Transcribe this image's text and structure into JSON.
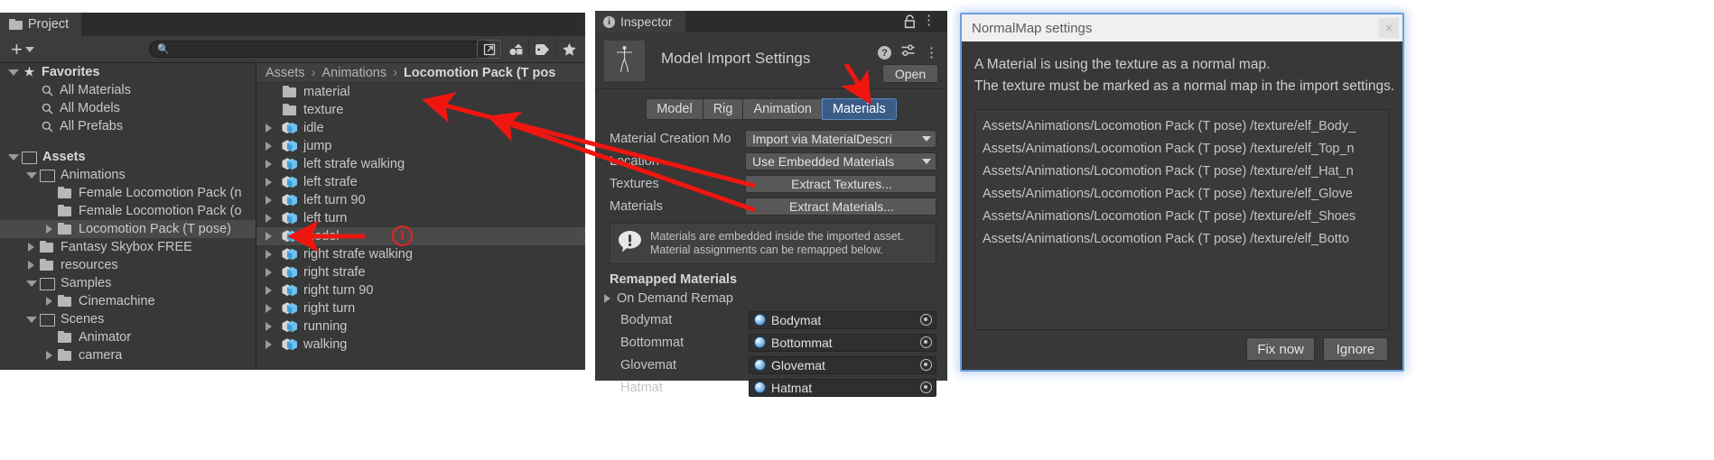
{
  "project_panel": {
    "tab_label": "Project",
    "toolbar": {
      "add_label": "+",
      "search_placeholder": "",
      "search_value": "",
      "icons": [
        "open-in-new-icon",
        "filter-by-type-icon",
        "filter-by-label-icon",
        "favorite-star-icon"
      ]
    },
    "tree": [
      {
        "label": "Favorites",
        "depth": 0,
        "twisty": "down",
        "icon": "star-icon",
        "bold": true,
        "selected": false
      },
      {
        "label": "All Materials",
        "depth": 1,
        "twisty": "none",
        "icon": "search-icon",
        "bold": false,
        "selected": false
      },
      {
        "label": "All Models",
        "depth": 1,
        "twisty": "none",
        "icon": "search-icon",
        "bold": false,
        "selected": false
      },
      {
        "label": "All Prefabs",
        "depth": 1,
        "twisty": "none",
        "icon": "search-icon",
        "bold": false,
        "selected": false
      },
      {
        "label": "",
        "depth": 0,
        "twisty": "none",
        "icon": "none",
        "bold": false,
        "selected": false
      },
      {
        "label": "Assets",
        "depth": 0,
        "twisty": "down",
        "icon": "folder-open-icon",
        "bold": true,
        "selected": false
      },
      {
        "label": "Animations",
        "depth": 1,
        "twisty": "down",
        "icon": "folder-open-icon",
        "bold": false,
        "selected": false
      },
      {
        "label": "Female Locomotion Pack  (n",
        "depth": 2,
        "twisty": "none",
        "icon": "folder-icon",
        "bold": false,
        "selected": false
      },
      {
        "label": "Female Locomotion Pack  (o",
        "depth": 2,
        "twisty": "none",
        "icon": "folder-icon",
        "bold": false,
        "selected": false
      },
      {
        "label": "Locomotion Pack  (T pose)",
        "depth": 2,
        "twisty": "right",
        "icon": "folder-icon",
        "bold": false,
        "selected": true
      },
      {
        "label": "Fantasy Skybox FREE",
        "depth": 1,
        "twisty": "right",
        "icon": "folder-icon",
        "bold": false,
        "selected": false
      },
      {
        "label": "resources",
        "depth": 1,
        "twisty": "right",
        "icon": "folder-icon",
        "bold": false,
        "selected": false
      },
      {
        "label": "Samples",
        "depth": 1,
        "twisty": "down",
        "icon": "folder-open-icon",
        "bold": false,
        "selected": false
      },
      {
        "label": "Cinemachine",
        "depth": 2,
        "twisty": "right",
        "icon": "folder-icon",
        "bold": false,
        "selected": false
      },
      {
        "label": "Scenes",
        "depth": 1,
        "twisty": "down",
        "icon": "folder-open-icon",
        "bold": false,
        "selected": false
      },
      {
        "label": "Animator",
        "depth": 2,
        "twisty": "none",
        "icon": "folder-icon",
        "bold": false,
        "selected": false
      },
      {
        "label": "camera",
        "depth": 2,
        "twisty": "right",
        "icon": "folder-icon",
        "bold": false,
        "selected": false
      }
    ],
    "breadcrumb": {
      "parts": [
        "Assets",
        "Animations"
      ],
      "current": "Locomotion Pack  (T pos"
    },
    "files": [
      {
        "label": "material",
        "icon": "folder-icon",
        "twisty": "none",
        "selected": false
      },
      {
        "label": "texture",
        "icon": "folder-icon",
        "twisty": "none",
        "selected": false
      },
      {
        "label": "idle",
        "icon": "model-icon",
        "twisty": "right",
        "selected": false
      },
      {
        "label": "jump",
        "icon": "model-icon",
        "twisty": "right",
        "selected": false
      },
      {
        "label": "left strafe walking",
        "icon": "model-icon",
        "twisty": "right",
        "selected": false
      },
      {
        "label": "left strafe",
        "icon": "model-icon",
        "twisty": "right",
        "selected": false
      },
      {
        "label": "left turn 90",
        "icon": "model-icon",
        "twisty": "right",
        "selected": false
      },
      {
        "label": "left turn",
        "icon": "model-icon",
        "twisty": "right",
        "selected": false
      },
      {
        "label": "model",
        "icon": "model-icon",
        "twisty": "right",
        "selected": true
      },
      {
        "label": "right strafe walking",
        "icon": "model-icon",
        "twisty": "right",
        "selected": false
      },
      {
        "label": "right strafe",
        "icon": "model-icon",
        "twisty": "right",
        "selected": false
      },
      {
        "label": "right turn 90",
        "icon": "model-icon",
        "twisty": "right",
        "selected": false
      },
      {
        "label": "right turn",
        "icon": "model-icon",
        "twisty": "right",
        "selected": false
      },
      {
        "label": "running",
        "icon": "model-icon",
        "twisty": "right",
        "selected": false
      },
      {
        "label": "walking",
        "icon": "model-icon",
        "twisty": "right",
        "selected": false
      }
    ]
  },
  "inspector": {
    "tab_label": "Inspector",
    "title": "Model Import Settings",
    "open_button": "Open",
    "tabs": [
      {
        "label": "Model",
        "active": false
      },
      {
        "label": "Rig",
        "active": false
      },
      {
        "label": "Animation",
        "active": false
      },
      {
        "label": "Materials",
        "active": true
      }
    ],
    "fields": [
      {
        "label": "Material Creation Mo",
        "value": "Import via MaterialDescri"
      },
      {
        "label": "Location",
        "value": "Use Embedded Materials"
      }
    ],
    "buttons": [
      {
        "label": "Textures",
        "button": "Extract Textures..."
      },
      {
        "label": "Materials",
        "button": "Extract Materials..."
      }
    ],
    "helpbox": {
      "line1": "Materials are embedded inside the imported asset.",
      "line2": "Material assignments can be remapped below."
    },
    "remapped_title": "Remapped Materials",
    "on_demand_remap": "On Demand Remap",
    "remapped_materials": [
      {
        "label": "Bodymat",
        "value": "Bodymat"
      },
      {
        "label": "Bottommat",
        "value": "Bottommat"
      },
      {
        "label": "Glovemat",
        "value": "Glovemat"
      },
      {
        "label": "Hatmat",
        "value": "Hatmat"
      }
    ]
  },
  "normalmap_dialog": {
    "title": "NormalMap settings",
    "close_label": "×",
    "message_line1": "A Material is using the texture as a normal map.",
    "message_line2": "The texture must be marked as a normal map in the import settings.",
    "paths": [
      "Assets/Animations/Locomotion Pack  (T pose) /texture/elf_Body_",
      "Assets/Animations/Locomotion Pack  (T pose) /texture/elf_Top_n",
      "Assets/Animations/Locomotion Pack  (T pose) /texture/elf_Hat_n",
      "Assets/Animations/Locomotion Pack  (T pose) /texture/elf_Glove",
      "Assets/Animations/Locomotion Pack  (T pose) /texture/elf_Shoes",
      "Assets/Animations/Locomotion Pack  (T pose) /texture/elf_Botto"
    ],
    "fix_now_label": "Fix now",
    "ignore_label": "Ignore"
  },
  "annotations": {
    "step_badge": "1",
    "accent_color": "#e8231f"
  }
}
